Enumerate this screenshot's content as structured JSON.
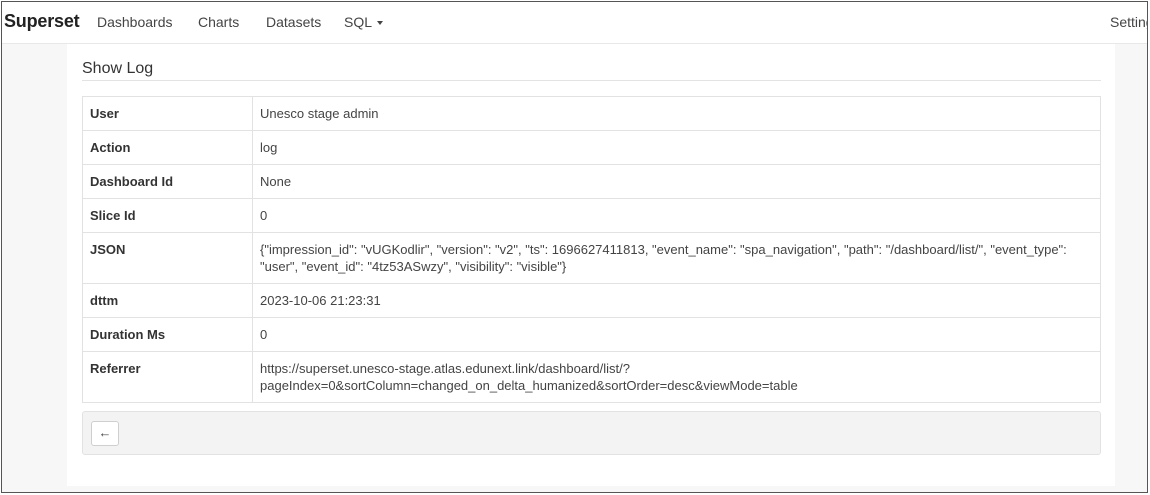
{
  "navbar": {
    "brand": "Superset",
    "items": [
      {
        "label": "Dashboards"
      },
      {
        "label": "Charts"
      },
      {
        "label": "Datasets"
      },
      {
        "label": "SQL"
      }
    ],
    "settings_label": "Settings"
  },
  "panel": {
    "title": "Show Log",
    "rows": [
      {
        "key": "User",
        "value": "Unesco stage admin"
      },
      {
        "key": "Action",
        "value": "log"
      },
      {
        "key": "Dashboard Id",
        "value": "None"
      },
      {
        "key": "Slice Id",
        "value": "0"
      },
      {
        "key": "JSON",
        "value": "{\"impression_id\": \"vUGKodlir\", \"version\": \"v2\", \"ts\": 1696627411813, \"event_name\": \"spa_navigation\", \"path\": \"/dashboard/list/\", \"event_type\": \"user\", \"event_id\": \"4tz53ASwzy\", \"visibility\": \"visible\"}"
      },
      {
        "key": "dttm",
        "value": "2023-10-06 21:23:31"
      },
      {
        "key": "Duration Ms",
        "value": "0"
      },
      {
        "key": "Referrer",
        "value": "https://superset.unesco-stage.atlas.edunext.link/dashboard/list/?pageIndex=0&sortColumn=changed_on_delta_humanized&sortOrder=desc&viewMode=table"
      }
    ]
  },
  "footer": {
    "back_icon": "←",
    "back_icon_name": "arrow-left-icon"
  }
}
